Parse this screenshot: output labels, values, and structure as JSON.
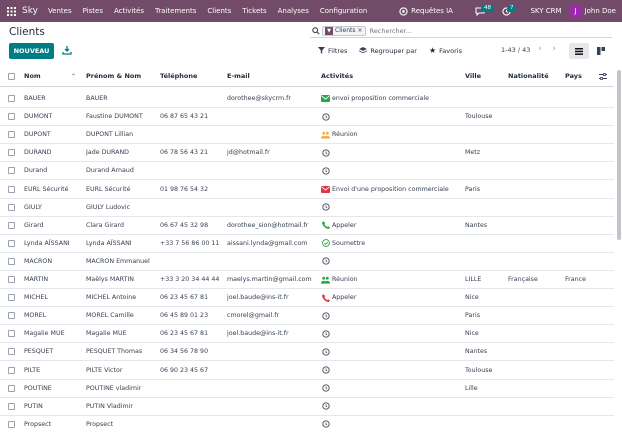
{
  "nav": {
    "brand": "Sky",
    "menu": [
      "Ventes",
      "Pistes",
      "Activités",
      "Traitements",
      "Clients",
      "Tickets",
      "Analyses",
      "Configuration"
    ],
    "requetes": "Requêtes IA",
    "badge_chat": "48",
    "badge_clock": "7",
    "company": "SKY CRM",
    "user": "John Doe",
    "avatar_letter": "J"
  },
  "page": {
    "title": "Clients",
    "new_label": "NOUVEAU",
    "facet_label": "Clients",
    "search_placeholder": "Rechercher...",
    "filters_label": "Filtres",
    "group_label": "Regrouper par",
    "fav_label": "Favoris",
    "pager": "1-43 / 43"
  },
  "columns": [
    "Nom",
    "Prénom & Nom",
    "Téléphone",
    "E-mail",
    "Activités",
    "Ville",
    "Nationalité",
    "Pays"
  ],
  "rows": [
    {
      "nom": "BAUER",
      "prenom": "BAUER",
      "tel": "",
      "email": "dorothee@skycrm.fr",
      "act": "envoi proposition commerciale",
      "act_icon": "mail-green-icon",
      "ville": "",
      "nat": "",
      "pays": ""
    },
    {
      "nom": "DUMONT",
      "prenom": "Faustine DUMONT",
      "tel": "06 87 65 43 21",
      "email": "",
      "act": "",
      "act_icon": "clock-icon",
      "ville": "Toulouse",
      "nat": "",
      "pays": ""
    },
    {
      "nom": "DUPONT",
      "prenom": "DUPONT Lillian",
      "tel": "",
      "email": "",
      "act": "Réunion",
      "act_icon": "meeting-icon",
      "ville": "",
      "nat": "",
      "pays": ""
    },
    {
      "nom": "DURAND",
      "prenom": "Jade DURAND",
      "tel": "06 78 56 43 21",
      "email": "jd@hotmail.fr",
      "act": "",
      "act_icon": "clock-icon",
      "ville": "Metz",
      "nat": "",
      "pays": ""
    },
    {
      "nom": "Durand",
      "prenom": "Durand Arnaud",
      "tel": "",
      "email": "",
      "act": "",
      "act_icon": "clock-icon",
      "ville": "",
      "nat": "",
      "pays": ""
    },
    {
      "nom": "EURL Sécurité",
      "prenom": "EURL Sécurité",
      "tel": "01 98 76 54 32",
      "email": "",
      "act": "Envoi d'une proposition commerciale",
      "act_icon": "mail-red-icon",
      "ville": "Paris",
      "nat": "",
      "pays": ""
    },
    {
      "nom": "GIULY",
      "prenom": "GIULY Ludovic",
      "tel": "",
      "email": "",
      "act": "",
      "act_icon": "clock-icon",
      "ville": "",
      "nat": "",
      "pays": ""
    },
    {
      "nom": "Girard",
      "prenom": "Clara Girard",
      "tel": "06 67 45 32 98",
      "email": "dorothee_sion@hotmail.fr",
      "act": "Appeler",
      "act_icon": "phone-green-icon",
      "ville": "Nantes",
      "nat": "",
      "pays": ""
    },
    {
      "nom": "Lynda AÏSSANI",
      "prenom": "Lynda AÏSSANI",
      "tel": "+33 7 56 86 00 11",
      "email": "aissani.lynda@gmail.com",
      "act": "Soumettre",
      "act_icon": "check-icon",
      "ville": "",
      "nat": "",
      "pays": ""
    },
    {
      "nom": "MACRON",
      "prenom": "MACRON Emmanuel",
      "tel": "",
      "email": "",
      "act": "",
      "act_icon": "clock-icon",
      "ville": "",
      "nat": "",
      "pays": ""
    },
    {
      "nom": "MARTIN",
      "prenom": "Maëlys MARTIN",
      "tel": "+33 3 20 34 44 44",
      "email": "maelys.martin@gmail.com",
      "act": "Réunion",
      "act_icon": "meeting-green-icon",
      "ville": "LILLE",
      "nat": "Française",
      "pays": "France"
    },
    {
      "nom": "MICHEL",
      "prenom": "MICHEL Antoine",
      "tel": "06 23 45 67 81",
      "email": "joel.baude@ins-it.fr",
      "act": "Appeler",
      "act_icon": "phone-red-icon",
      "ville": "Nice",
      "nat": "",
      "pays": ""
    },
    {
      "nom": "MOREL",
      "prenom": "MOREL Camille",
      "tel": "06 45 89 01 23",
      "email": "cmorel@gmail.fr",
      "act": "",
      "act_icon": "clock-icon",
      "ville": "Paris",
      "nat": "",
      "pays": ""
    },
    {
      "nom": "Magalie MUE",
      "prenom": "Magalie MUE",
      "tel": "06 23 45 67 81",
      "email": "joel.baude@ins-it.fr",
      "act": "",
      "act_icon": "clock-icon",
      "ville": "Nice",
      "nat": "",
      "pays": ""
    },
    {
      "nom": "PESQUET",
      "prenom": "PESQUET Thomas",
      "tel": "06 34 56 78 90",
      "email": "",
      "act": "",
      "act_icon": "clock-icon",
      "ville": "Nantes",
      "nat": "",
      "pays": ""
    },
    {
      "nom": "PILTE",
      "prenom": "PILTE Victor",
      "tel": "06 90 23 45 67",
      "email": "",
      "act": "",
      "act_icon": "clock-icon",
      "ville": "Toulouse",
      "nat": "",
      "pays": ""
    },
    {
      "nom": "POUTINE",
      "prenom": "POUTINE vladimir",
      "tel": "",
      "email": "",
      "act": "",
      "act_icon": "clock-icon",
      "ville": "Lille",
      "nat": "",
      "pays": ""
    },
    {
      "nom": "PUTIN",
      "prenom": "PUTIN Vladimir",
      "tel": "",
      "email": "",
      "act": "",
      "act_icon": "clock-icon",
      "ville": "",
      "nat": "",
      "pays": ""
    },
    {
      "nom": "Propsect",
      "prenom": "Propsect",
      "tel": "",
      "email": "",
      "act": "",
      "act_icon": "clock-icon",
      "ville": "",
      "nat": "",
      "pays": ""
    }
  ],
  "colors": {
    "brand": "#714B67",
    "primary": "#017e84"
  }
}
